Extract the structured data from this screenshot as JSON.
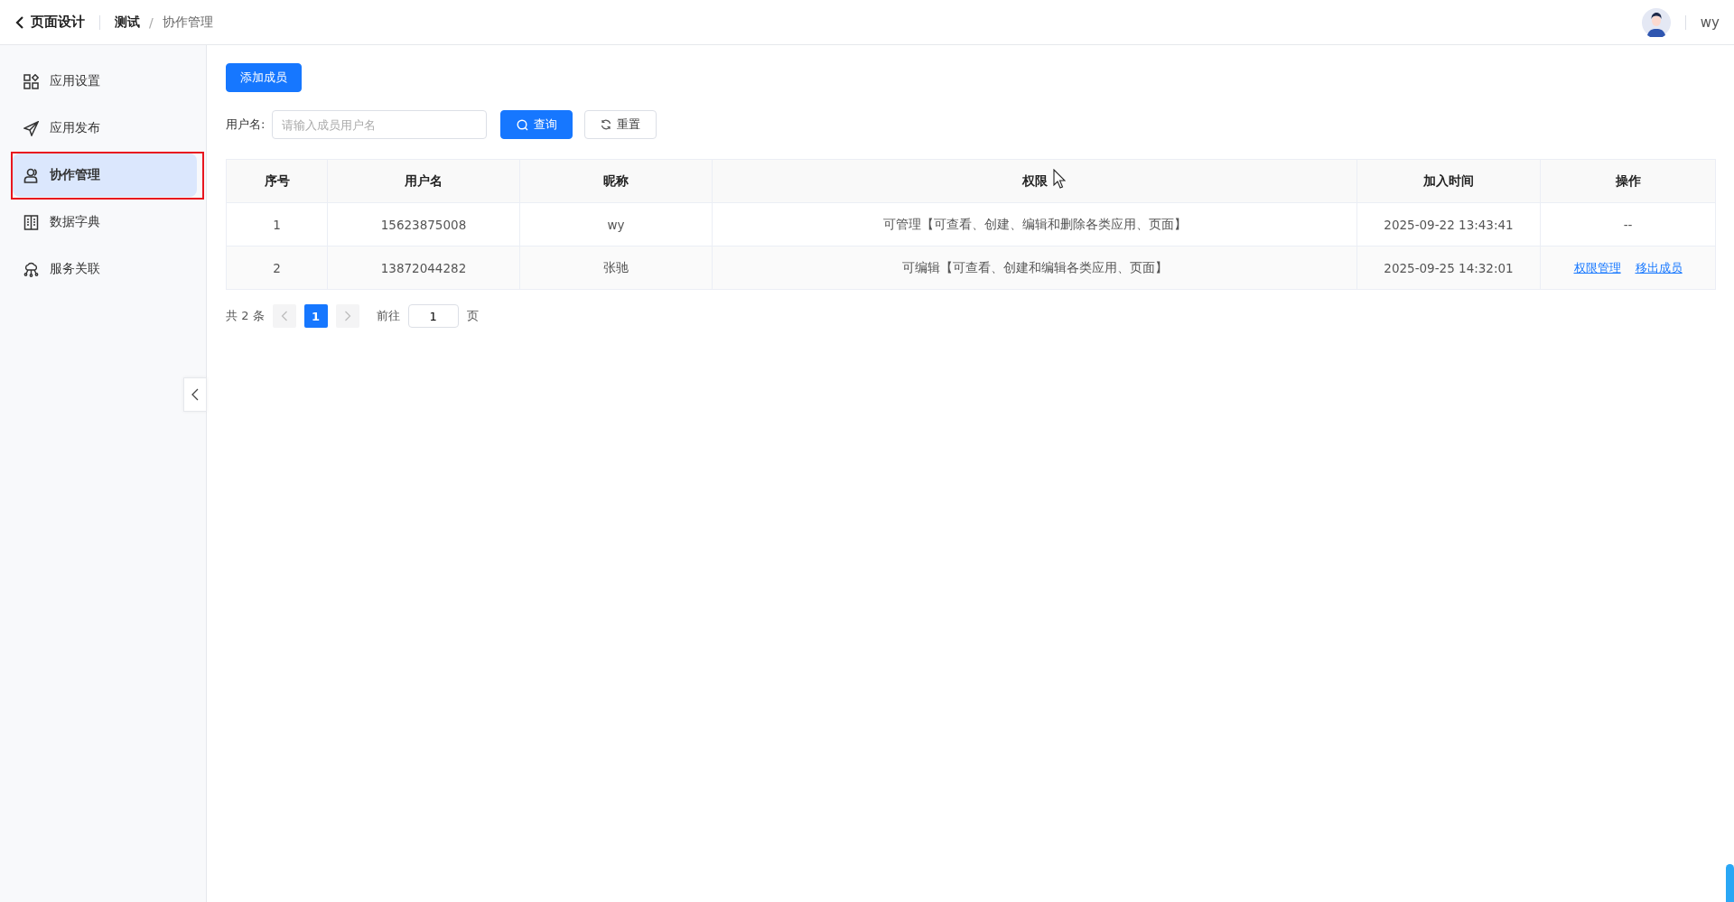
{
  "header": {
    "back_title": "页面设计",
    "breadcrumb_separator": "/",
    "breadcrumb": [
      {
        "label": "测试",
        "selected": false
      },
      {
        "label": "协作管理",
        "selected": true
      }
    ],
    "user": "wy"
  },
  "sidebar": {
    "items": [
      {
        "label": "应用设置",
        "selected": false,
        "highlighted": false
      },
      {
        "label": "应用发布",
        "selected": false,
        "highlighted": false
      },
      {
        "label": "协作管理",
        "selected": true,
        "highlighted": true
      },
      {
        "label": "数据字典",
        "selected": false,
        "highlighted": false
      },
      {
        "label": "服务关联",
        "selected": false,
        "highlighted": false
      }
    ]
  },
  "toolbar": {
    "add_button": "添加成员",
    "filter_label": "用户名:",
    "search": {
      "placeholder": "请输入成员用户名"
    },
    "query_button": "查询",
    "reset_button": "重置"
  },
  "table": {
    "columns": [
      "序号",
      "用户名",
      "昵称",
      "权限",
      "加入时间",
      "操作"
    ],
    "rows": [
      {
        "index": "1",
        "username": "15623875008",
        "nickname": "wy",
        "permission": "可管理【可查看、创建、编辑和删除各类应用、页面】",
        "joined": "2025-09-22 13:43:41",
        "actions": [],
        "empty_action": "--"
      },
      {
        "index": "2",
        "username": "13872044282",
        "nickname": "张驰",
        "permission": "可编辑【可查看、创建和编辑各类应用、页面】",
        "joined": "2025-09-25 14:32:01",
        "actions": [
          "权限管理",
          "移出成员"
        ]
      }
    ]
  },
  "pagination": {
    "total": "共 2 条",
    "pages": [
      {
        "label": "1",
        "selected": true
      }
    ],
    "goto_label": "前往",
    "goto_value": "1",
    "page_suffix": "页"
  }
}
